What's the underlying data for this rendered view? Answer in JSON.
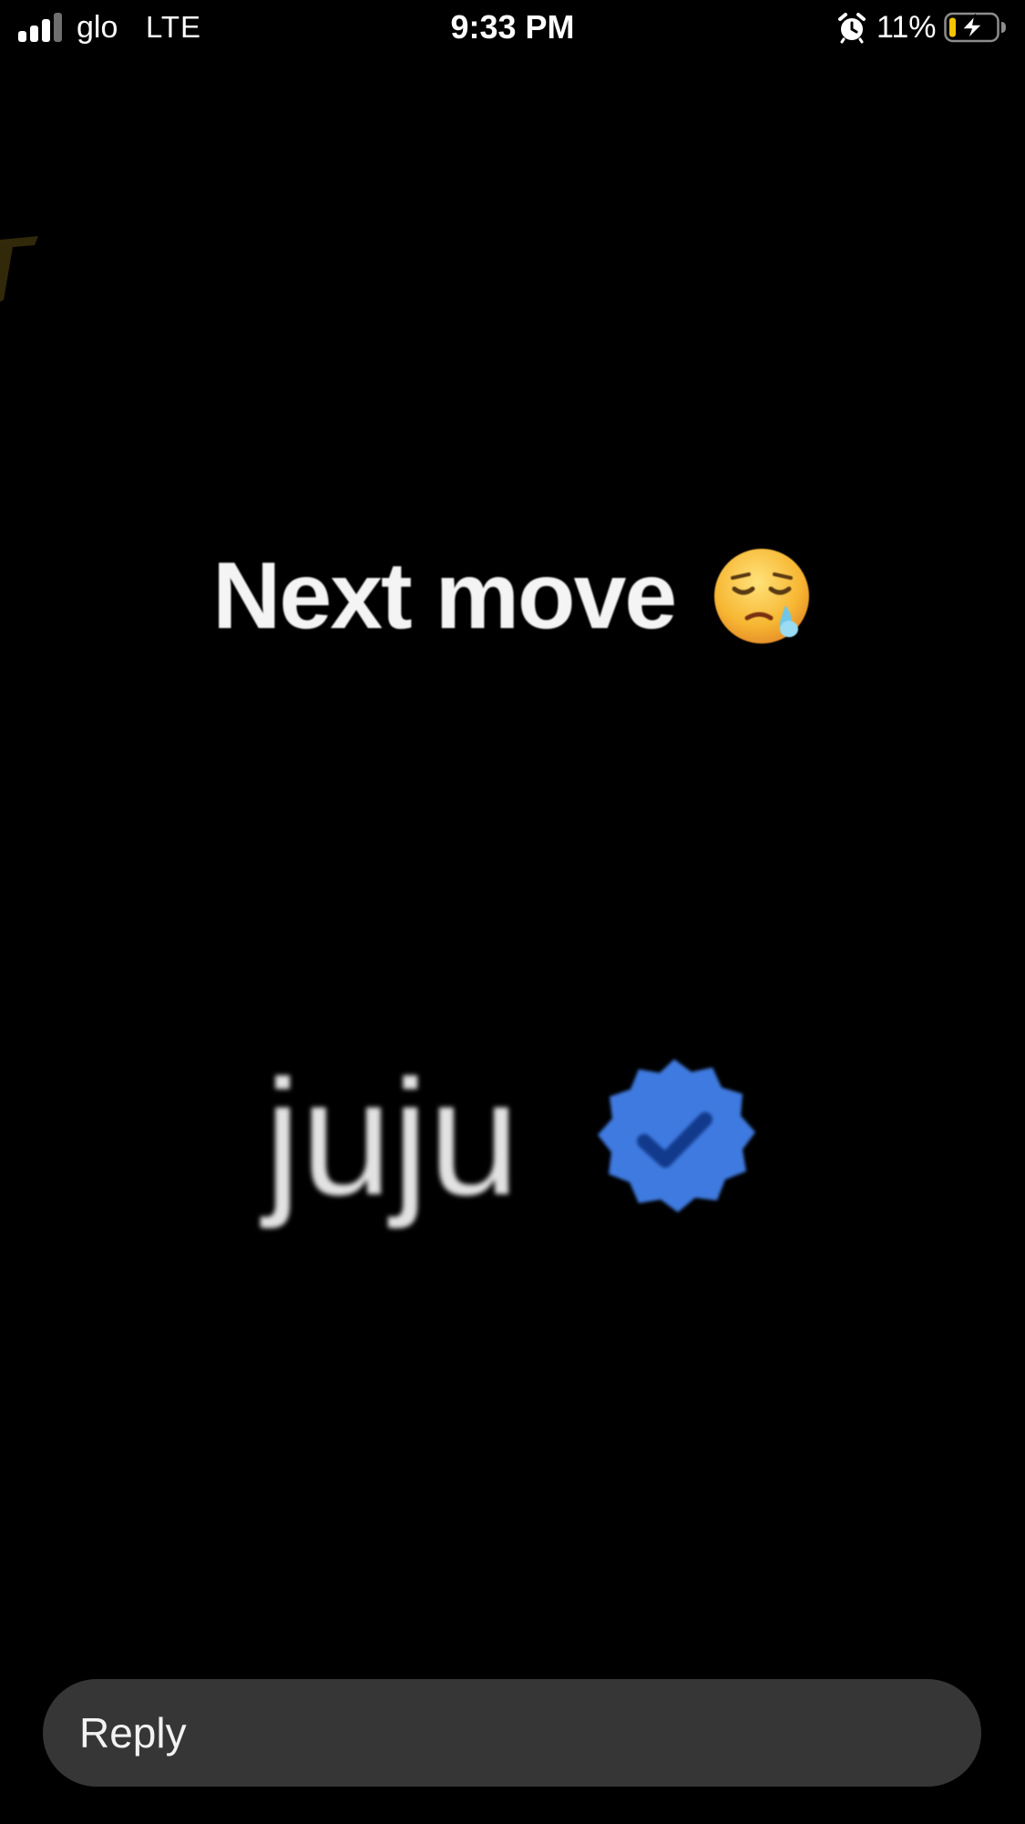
{
  "status_bar": {
    "carrier": "glo",
    "network": "LTE",
    "time": "9:33 PM",
    "battery_percent": "11%",
    "signal_bars_filled": 3,
    "signal_bars_total": 4,
    "battery_level": 0.11,
    "battery_charging": true,
    "icons": [
      "signal-icon",
      "alarm-icon",
      "battery-charging-icon"
    ]
  },
  "story": {
    "headline": "Next move",
    "headline_emoji": "sad-relieved-face-emoji",
    "name": "juju",
    "badge_icon": "verified-badge-icon"
  },
  "reply": {
    "placeholder": "Reply"
  },
  "colors": {
    "background": "#000000",
    "reply_bar": "#363636",
    "verified_blue": "#3f7ae0",
    "battery_low": "#f5c400"
  }
}
